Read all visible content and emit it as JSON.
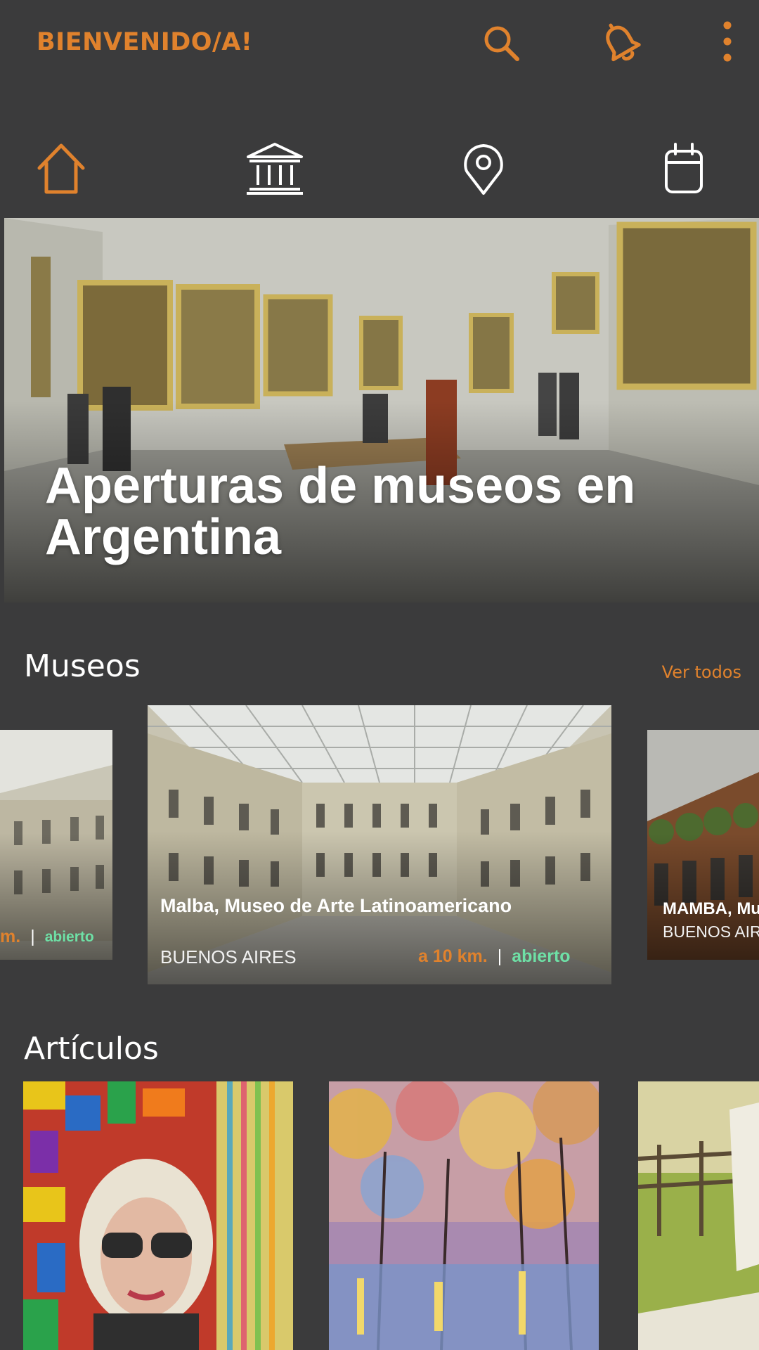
{
  "app": {
    "title": "BIENVENIDO/A!",
    "accent_color": "#e0822d",
    "background_color": "#3b3b3c",
    "open_status_color": "#6ee0a6"
  },
  "top_actions": [
    {
      "icon": "search-icon"
    },
    {
      "icon": "bell-icon"
    },
    {
      "icon": "more-vert-icon"
    }
  ],
  "nav": [
    {
      "icon": "home-icon",
      "active": true
    },
    {
      "icon": "museum-icon",
      "active": false
    },
    {
      "icon": "map-pin-icon",
      "active": false
    },
    {
      "icon": "calendar-icon",
      "active": false
    }
  ],
  "hero": {
    "title": "Aperturas de museos en Argentina"
  },
  "museums_section": {
    "title": "Museos",
    "see_all": "Ver todos",
    "cards": [
      {
        "name": "",
        "city": "",
        "distance": "m.",
        "status": "abierto"
      },
      {
        "name": "Malba, Museo de Arte Latinoamericano",
        "city": "BUENOS AIRES",
        "distance": "a 10 km.",
        "status": "abierto"
      },
      {
        "name": "MAMBA, Mu",
        "city": "BUENOS AIR",
        "distance": "",
        "status": ""
      }
    ]
  },
  "articles_section": {
    "title": "Artículos"
  }
}
